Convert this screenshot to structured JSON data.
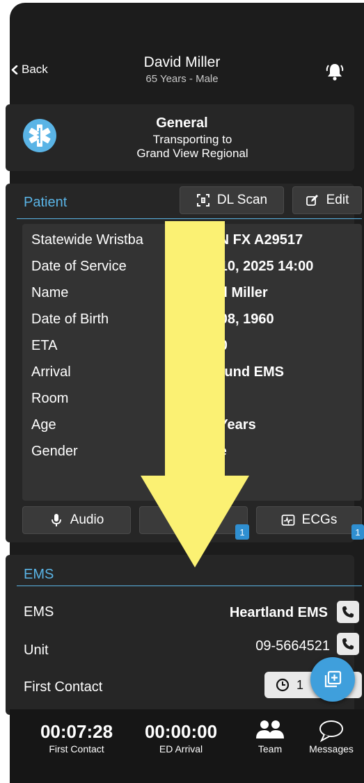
{
  "header": {
    "back_label": "Back",
    "name": "David Miller",
    "subtitle": "65 Years - Male"
  },
  "general": {
    "title": "General",
    "line1": "Transporting to",
    "line2": "Grand View Regional"
  },
  "patient": {
    "section_label": "Patient",
    "dl_scan_label": "DL Scan",
    "edit_label": "Edit",
    "rows": [
      {
        "label": "Statewide Wristba",
        "value": "MN FX A29517"
      },
      {
        "label": "Date of Service",
        "value": "n 10, 2025 14:00"
      },
      {
        "label": "Name",
        "value": "vid Miller"
      },
      {
        "label": "Date of Birth",
        "value": "b 08, 1960"
      },
      {
        "label": "ETA",
        "value": ":30"
      },
      {
        "label": "Arrival",
        "value": "bound EMS"
      },
      {
        "label": "Room",
        "value": ""
      },
      {
        "label": "Age",
        "value": "5 Years"
      },
      {
        "label": "Gender",
        "value": "ale"
      }
    ],
    "audio_label": "Audio",
    "middle_badge": "1",
    "ecgs_label": "ECGs",
    "ecgs_badge": "1"
  },
  "ems": {
    "section_label": "EMS",
    "ems_label": "EMS",
    "ems_value": "Heartland EMS",
    "unit_label": "Unit",
    "unit_value": "09-5664521",
    "first_contact_label": "First Contact",
    "first_contact_value": "1"
  },
  "tabbar": {
    "first_contact_time": "00:07:28",
    "first_contact_label": "First Contact",
    "ed_arrival_time": "00:00:00",
    "ed_arrival_label": "ED Arrival",
    "team_label": "Team",
    "messages_label": "Messages"
  },
  "colors": {
    "accent": "#5ab4e6",
    "background": "#1c1c1c",
    "arrow": "#fbf173",
    "badge": "#2f8fd1"
  },
  "icons": [
    "chevron-left-icon",
    "bell-icon",
    "star-of-life-icon",
    "id-scan-icon",
    "edit-icon",
    "microphone-icon",
    "ecg-icon",
    "phone-icon",
    "clock-icon",
    "add-record-icon",
    "team-icon",
    "messages-icon",
    "down-arrow-overlay"
  ]
}
